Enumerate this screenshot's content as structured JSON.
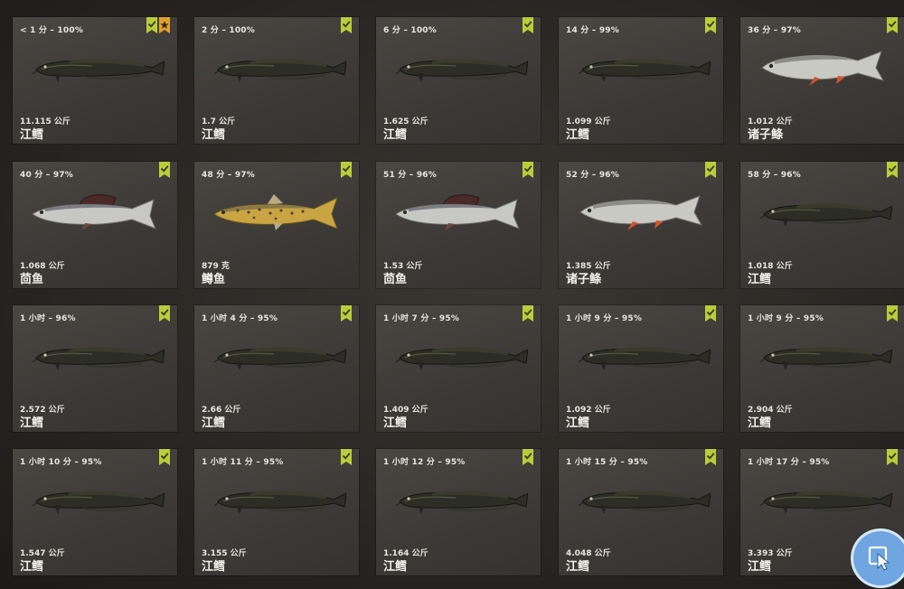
{
  "catches": [
    {
      "time": "< 1 分 – 100%",
      "weight": "11.115 公斤",
      "name": "江鳕",
      "species": "burbot",
      "trophy": true
    },
    {
      "time": "2 分 – 100%",
      "weight": "1.7 公斤",
      "name": "江鳕",
      "species": "burbot",
      "trophy": false
    },
    {
      "time": "6 分 – 100%",
      "weight": "1.625 公斤",
      "name": "江鳕",
      "species": "burbot",
      "trophy": false
    },
    {
      "time": "14 分 – 99%",
      "weight": "1.099 公斤",
      "name": "江鳕",
      "species": "burbot",
      "trophy": false
    },
    {
      "time": "36 分 – 97%",
      "weight": "1.012 公斤",
      "name": "诸子鲦",
      "species": "chub",
      "trophy": false
    },
    {
      "time": "40 分 – 97%",
      "weight": "1.068 公斤",
      "name": "茴鱼",
      "species": "grayling",
      "trophy": false
    },
    {
      "time": "48 分 – 97%",
      "weight": "879 克",
      "name": "鳟鱼",
      "species": "trout",
      "trophy": false
    },
    {
      "time": "51 分 – 96%",
      "weight": "1.53 公斤",
      "name": "茴鱼",
      "species": "grayling",
      "trophy": false
    },
    {
      "time": "52 分 – 96%",
      "weight": "1.385 公斤",
      "name": "诸子鲦",
      "species": "chub",
      "trophy": false
    },
    {
      "time": "58 分 – 96%",
      "weight": "1.018 公斤",
      "name": "江鳕",
      "species": "burbot",
      "trophy": false
    },
    {
      "time": "1 小时 – 96%",
      "weight": "2.572 公斤",
      "name": "江鳕",
      "species": "burbot",
      "trophy": false
    },
    {
      "time": "1 小时 4 分 – 95%",
      "weight": "2.66 公斤",
      "name": "江鳕",
      "species": "burbot",
      "trophy": false
    },
    {
      "time": "1 小时 7 分 – 95%",
      "weight": "1.409 公斤",
      "name": "江鳕",
      "species": "burbot",
      "trophy": false
    },
    {
      "time": "1 小时 9 分 – 95%",
      "weight": "1.092 公斤",
      "name": "江鳕",
      "species": "burbot",
      "trophy": false
    },
    {
      "time": "1 小时 9 分 – 95%",
      "weight": "2.904 公斤",
      "name": "江鳕",
      "species": "burbot",
      "trophy": false
    },
    {
      "time": "1 小时 10 分 – 95%",
      "weight": "1.547 公斤",
      "name": "江鳕",
      "species": "burbot",
      "trophy": false
    },
    {
      "time": "1 小时 11 分 – 95%",
      "weight": "3.155 公斤",
      "name": "江鳕",
      "species": "burbot",
      "trophy": false
    },
    {
      "time": "1 小时 12 分 – 95%",
      "weight": "1.164 公斤",
      "name": "江鳕",
      "species": "burbot",
      "trophy": false
    },
    {
      "time": "1 小时 15 分 – 95%",
      "weight": "4.048 公斤",
      "name": "江鳕",
      "species": "burbot",
      "trophy": false
    },
    {
      "time": "1 小时 17 分 – 95%",
      "weight": "3.393 公斤",
      "name": "江鳕",
      "species": "burbot",
      "trophy": false
    }
  ],
  "colors": {
    "ribbon_green": "#b9cc3c",
    "ribbon_orange": "#e3a12d",
    "cursor_button": "#6fa5e0"
  },
  "icons": {
    "check": "check-ribbon-icon",
    "trophy": "star-ribbon-icon",
    "cursor": "mouse-pointer-icon"
  }
}
